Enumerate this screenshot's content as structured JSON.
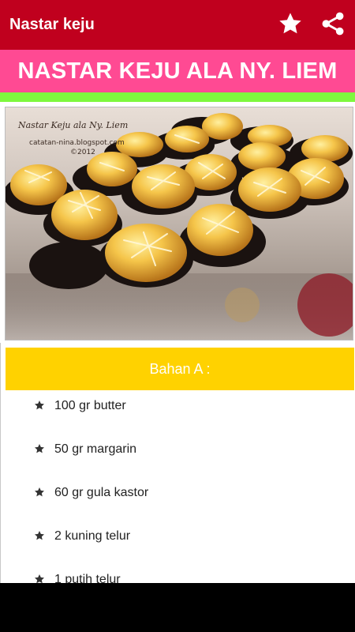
{
  "appbar": {
    "title": "Nastar keju",
    "actions": [
      {
        "icon": "star-icon"
      },
      {
        "icon": "share-icon"
      }
    ]
  },
  "banner": {
    "title": "NASTAR KEJU ALA NY. LIEM"
  },
  "photo": {
    "caption": "Nastar Keju ala Ny. Liem",
    "url": "catatan-nina.blogspot.com",
    "year": "©2012"
  },
  "section": {
    "title": "Bahan A :",
    "items": [
      "100 gr butter",
      "50 gr margarin",
      "60 gr gula kastor",
      "2 kuning telur",
      "1 putih telur"
    ]
  },
  "colors": {
    "appbar": "#c0001e",
    "banner": "#ff4a93",
    "banner_line": "#7ef83e",
    "section_header": "#ffd200"
  }
}
